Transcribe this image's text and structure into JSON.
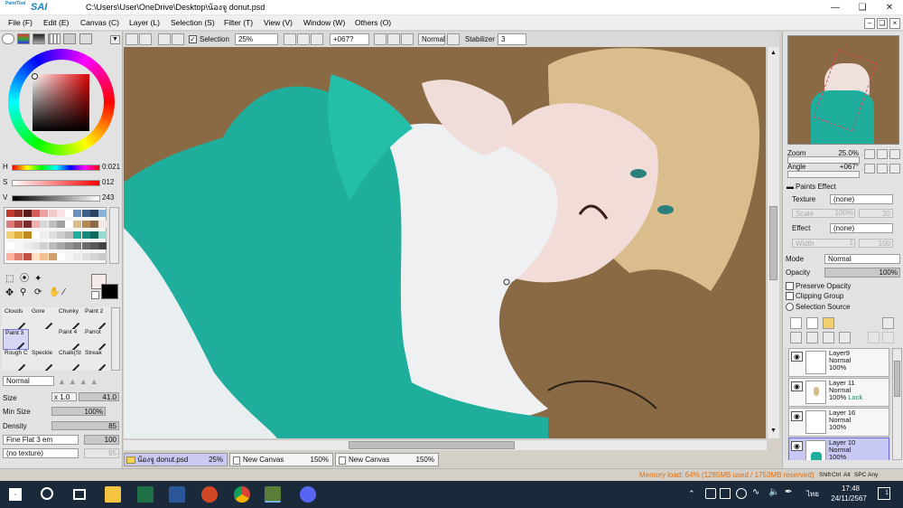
{
  "app": {
    "logo": "SAI",
    "logo_small": "PaintTool",
    "title_path": "C:\\Users\\User\\OneDrive\\Desktop\\น้องจู donut.psd"
  },
  "menu": [
    "File (F)",
    "Edit (E)",
    "Canvas (C)",
    "Layer (L)",
    "Selection (S)",
    "Filter (T)",
    "View (V)",
    "Window (W)",
    "Others (O)"
  ],
  "toolbar": {
    "selection_label": "Selection",
    "zoom": "25%",
    "angle": "+067?",
    "mode": "Normal",
    "stabilizer_label": "Stabilizer",
    "stabilizer_value": "3"
  },
  "color": {
    "h_label": "H",
    "h_value": "0:021",
    "s_label": "S",
    "s_value": "012",
    "v_label": "V",
    "v_value": "243",
    "fg": "#f3e9e6",
    "bg": "#000000"
  },
  "brushes": [
    {
      "label": "Clouds"
    },
    {
      "label": "Gore"
    },
    {
      "label": "Chunky"
    },
    {
      "label": "Paint 2"
    },
    {
      "label": "Paint 3"
    },
    {
      "label": ""
    },
    {
      "label": "Paint 4"
    },
    {
      "label": "Parrot"
    },
    {
      "label": "Rough C"
    },
    {
      "label": "Speckle"
    },
    {
      "label": "Chalk(St"
    },
    {
      "label": "Streak"
    }
  ],
  "brush_settings": {
    "mode": "Normal",
    "size_label": "Size",
    "size_mult": "x 1.0",
    "size_value": "41.0",
    "minsize_label": "Min Size",
    "minsize_value": "100%",
    "density_label": "Density",
    "density_value": "85",
    "shape": "Fine Flat 3 em",
    "shape_value": "100",
    "texture": "(no texture)",
    "texture_value": "95"
  },
  "navigator": {
    "zoom_label": "Zoom",
    "zoom_value": "25.0%",
    "angle_label": "Angle",
    "angle_value": "+067°"
  },
  "paints_effect": {
    "header": "Paints Effect",
    "texture_label": "Texture",
    "texture_value": "(none)",
    "scale_label": "Scale",
    "scale_pct": "100%",
    "scale_num": "20",
    "effect_label": "Effect",
    "effect_value": "(none)",
    "width_label": "Width",
    "width_val": "1",
    "width_num": "100"
  },
  "layer_props": {
    "mode_label": "Mode",
    "mode_value": "Normal",
    "opacity_label": "Opacity",
    "opacity_value": "100%",
    "preserve_opacity": "Preserve Opacity",
    "clipping_group": "Clipping Group",
    "selection_source": "Selection Source"
  },
  "layers": [
    {
      "name": "Layer9",
      "mode": "Normal",
      "opacity": "100%",
      "lock": ""
    },
    {
      "name": "Layer 11",
      "mode": "Normal",
      "opacity": "100%",
      "lock": "Lock"
    },
    {
      "name": "Layer 16",
      "mode": "Normal",
      "opacity": "100%",
      "lock": ""
    },
    {
      "name": "Layer 10",
      "mode": "Normal",
      "opacity": "100%",
      "lock": ""
    }
  ],
  "file_tabs": [
    {
      "name": "น้องจู donut.psd",
      "zoom": "25%"
    },
    {
      "name": "New Canvas",
      "zoom": "150%"
    },
    {
      "name": "New Canvas",
      "zoom": "150%"
    }
  ],
  "status": {
    "memory": "Memory load: 64% (1285MB used / 1753MB reserved)",
    "keys": [
      "Shift",
      "Ctrl",
      "Alt",
      "SPC",
      "Any"
    ]
  },
  "taskbar": {
    "lang": "ไทย",
    "time": "17:48",
    "date": "24/11/2567",
    "notif": "1"
  }
}
